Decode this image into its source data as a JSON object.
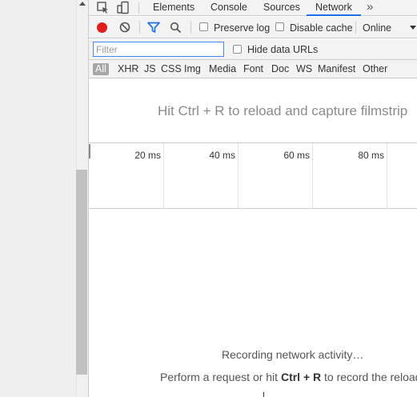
{
  "tabs": {
    "elements": "Elements",
    "console": "Console",
    "sources": "Sources",
    "network": "Network",
    "more": "»"
  },
  "toolbar": {
    "record_icon": "record-icon",
    "clear_icon": "clear-icon",
    "filter_icon": "filter-icon",
    "search_icon": "search-icon",
    "preserve_log": "Preserve log",
    "disable_cache": "Disable cache",
    "throttling": "Online",
    "record_color": "#e01e1e",
    "filter_color": "#1a73e8"
  },
  "filter": {
    "placeholder": "Filter",
    "hide_data_urls": "Hide data URLs"
  },
  "types": [
    "All",
    "XHR",
    "JS",
    "CSS",
    "Img",
    "Media",
    "Font",
    "Doc",
    "WS",
    "Manifest",
    "Other"
  ],
  "filmstrip": {
    "message": "Hit Ctrl + R to reload and capture filmstrip"
  },
  "overview": {
    "ticks": [
      "20 ms",
      "40 ms",
      "60 ms",
      "80 ms"
    ]
  },
  "empty": {
    "recording": "Recording network activity…",
    "perform_prefix": "Perform a request or hit ",
    "perform_keys": "Ctrl + R",
    "perform_suffix": " to record the reload."
  }
}
